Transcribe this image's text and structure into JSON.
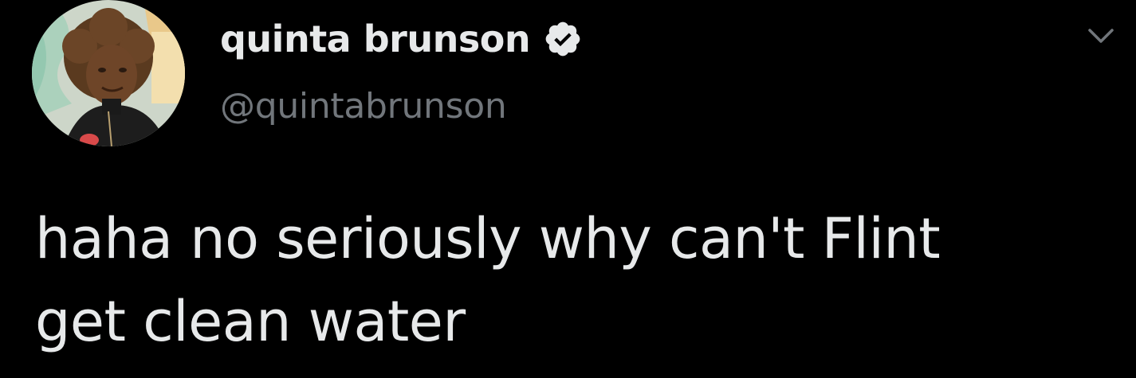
{
  "author": {
    "display_name": "quinta brunson",
    "handle": "@quintabrunson",
    "verified": true
  },
  "tweet": {
    "text": "haha no seriously why can't Flint\nget clean water"
  },
  "icons": {
    "verified": "verified-badge-icon",
    "menu": "chevron-down-icon"
  },
  "colors": {
    "background": "#000000",
    "primary_text": "#e7e9ea",
    "secondary_text": "#71767b"
  }
}
